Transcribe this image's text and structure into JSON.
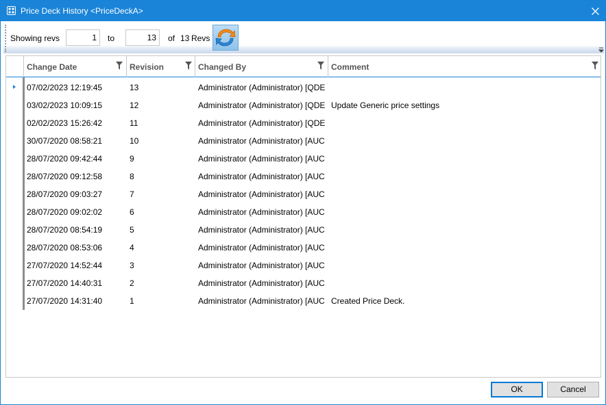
{
  "window": {
    "title": "Price Deck History <PriceDeckA>",
    "accent_color": "#1a84d8"
  },
  "toolbar": {
    "showing_label": "Showing revs",
    "from_value": "1",
    "to_label": "to",
    "to_value": "13",
    "of_label": "of",
    "total_count": "13",
    "revs_label": "Revs",
    "refresh_icon": "refresh-icon"
  },
  "grid": {
    "columns": [
      "Change Date",
      "Revision",
      "Changed By",
      "Comment"
    ],
    "rows": [
      {
        "date": "07/02/2023 12:19:45",
        "rev": "13",
        "by": "Administrator (Administrator) [QDE",
        "comment": ""
      },
      {
        "date": "03/02/2023 10:09:15",
        "rev": "12",
        "by": "Administrator (Administrator) [QDE",
        "comment": "Update Generic price settings"
      },
      {
        "date": "02/02/2023 15:26:42",
        "rev": "11",
        "by": "Administrator (Administrator) [QDE",
        "comment": ""
      },
      {
        "date": "30/07/2020 08:58:21",
        "rev": "10",
        "by": "Administrator (Administrator) [AUC",
        "comment": ""
      },
      {
        "date": "28/07/2020 09:42:44",
        "rev": "9",
        "by": "Administrator (Administrator) [AUC",
        "comment": ""
      },
      {
        "date": "28/07/2020 09:12:58",
        "rev": "8",
        "by": "Administrator (Administrator) [AUC",
        "comment": ""
      },
      {
        "date": "28/07/2020 09:03:27",
        "rev": "7",
        "by": "Administrator (Administrator) [AUC",
        "comment": ""
      },
      {
        "date": "28/07/2020 09:02:02",
        "rev": "6",
        "by": "Administrator (Administrator) [AUC",
        "comment": ""
      },
      {
        "date": "28/07/2020 08:54:19",
        "rev": "5",
        "by": "Administrator (Administrator) [AUC",
        "comment": ""
      },
      {
        "date": "28/07/2020 08:53:06",
        "rev": "4",
        "by": "Administrator (Administrator) [AUC",
        "comment": ""
      },
      {
        "date": "27/07/2020 14:52:44",
        "rev": "3",
        "by": "Administrator (Administrator) [AUC",
        "comment": ""
      },
      {
        "date": "27/07/2020 14:40:31",
        "rev": "2",
        "by": "Administrator (Administrator) [AUC",
        "comment": ""
      },
      {
        "date": "27/07/2020 14:31:40",
        "rev": "1",
        "by": "Administrator (Administrator) [AUC",
        "comment": "Created Price Deck."
      }
    ]
  },
  "footer": {
    "ok_label": "OK",
    "cancel_label": "Cancel"
  }
}
